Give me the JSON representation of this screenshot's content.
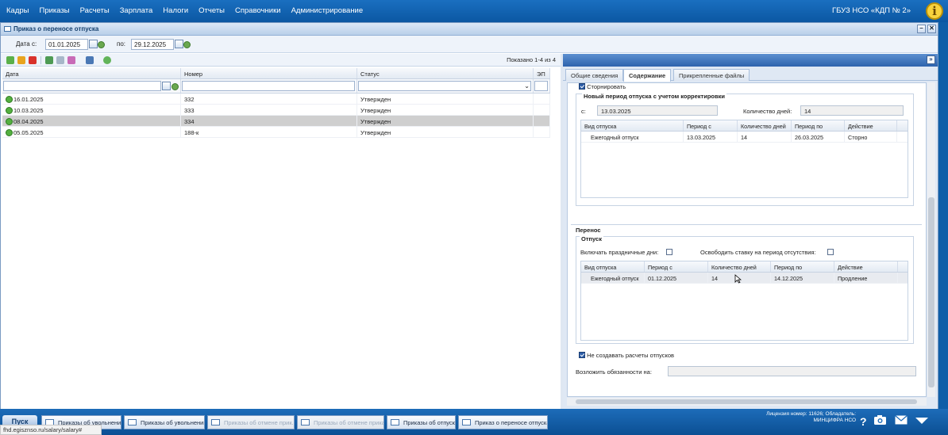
{
  "top_menu": {
    "items": [
      "Кадры",
      "Приказы",
      "Расчеты",
      "Зарплата",
      "Налоги",
      "Отчеты",
      "Справочники",
      "Администрирование"
    ],
    "org": "ГБУЗ НСО «КДП № 2»",
    "info_icon": "i"
  },
  "window": {
    "title": "Приказ о переносе отпуска",
    "minimize": "–",
    "close": "✕"
  },
  "filter": {
    "date_from_label": "Дата с:",
    "date_from": "01.01.2025",
    "date_to_label": "по:",
    "date_to": "29.12.2025"
  },
  "grid": {
    "shown": "Показано 1-4 из 4",
    "columns": [
      "Дата",
      "Номер",
      "Статус",
      "ЭП"
    ],
    "rows": [
      {
        "date": "16.01.2025",
        "number": "332",
        "status": "Утвержден",
        "ep": ""
      },
      {
        "date": "10.03.2025",
        "number": "333",
        "status": "Утвержден",
        "ep": ""
      },
      {
        "date": "08.04.2025",
        "number": "334",
        "status": "Утвержден",
        "ep": ""
      },
      {
        "date": "05.05.2025",
        "number": "188-к",
        "status": "Утвержден",
        "ep": ""
      }
    ],
    "selected_row": 2
  },
  "detail": {
    "tabs": [
      "Общие сведения",
      "Содержание",
      "Прикрепленные файлы"
    ],
    "active_tab": 1,
    "storno_label": "Сторнировать",
    "new_period": {
      "legend": "Новый период отпуска с учетом корректировки",
      "from_label": "с:",
      "from_value": "13.03.2025",
      "days_label": "Количество дней:",
      "days_value": "14",
      "columns": [
        "Вид отпуска",
        "Период с",
        "Количество дней",
        "Период по",
        "Действие"
      ],
      "rows": [
        {
          "type": "Ежегодный отпуск",
          "from": "13.03.2025",
          "days": "14",
          "to": "26.03.2025",
          "action": "Сторно"
        }
      ]
    },
    "transfer": {
      "legend": "Перенос",
      "sub_legend": "Отпуск",
      "holidays_label": "Включать праздничные дни:",
      "free_rate_label": "Освободить ставку на период отсутствия:",
      "columns": [
        "Вид отпуска",
        "Период с",
        "Количество дней",
        "Период по",
        "Действие"
      ],
      "rows": [
        {
          "type": "Ежегодный отпуск",
          "from": "01.12.2025",
          "days": "14",
          "to": "14.12.2025",
          "action": "Продление"
        }
      ]
    },
    "no_calc_label": "Не создавать расчеты отпусков",
    "duties_label": "Возложить обязанности на:",
    "duties_value": ""
  },
  "taskbar": {
    "start": "Пуск",
    "tasks": [
      {
        "label": "Приказы об увольнении",
        "dim": false
      },
      {
        "label": "Приказы об увольнении",
        "dim": false
      },
      {
        "label": "Приказы об отмене прик...",
        "dim": true
      },
      {
        "label": "Приказы об отмене прика...",
        "dim": true
      },
      {
        "label": "Приказы об отпуске",
        "dim": false
      },
      {
        "label": "Приказ о переносе отпуска",
        "dim": false
      }
    ],
    "license_line1": "Лицензия номер: 11626; Обладатель:",
    "license_line2": "МИНЦИФРА НСО",
    "help": "?",
    "url": "fhd.egisznso.ru/salary/salary#"
  }
}
